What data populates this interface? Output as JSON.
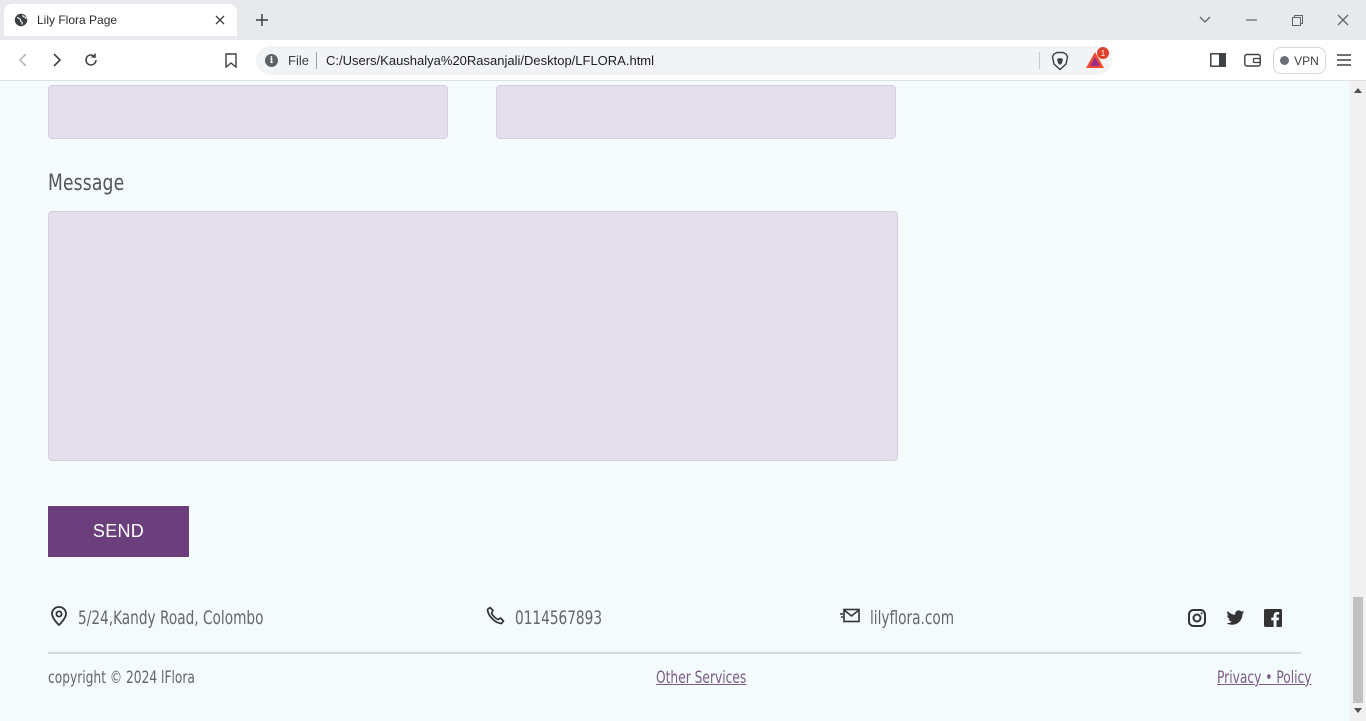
{
  "browser": {
    "tab_title": "Lily Flora Page",
    "scheme_label": "File",
    "url": "C:/Users/Kaushalya%20Rasanjali/Desktop/LFLORA.html",
    "rewards_badge": "1",
    "vpn_label": "VPN"
  },
  "form": {
    "message_label": "Message",
    "send_label": "SEND"
  },
  "footer": {
    "address": "5/24,Kandy Road, Colombo",
    "phone": "0114567893",
    "email": "lilyflora.com",
    "copyright": "copyright © 2024 lFlora",
    "other_services": "Other Services",
    "privacy": "Privacy • Policy"
  },
  "colors": {
    "page_bg": "#f3fbfd",
    "field_bg": "#e4dfea",
    "accent": "#6b3f7c"
  },
  "icons": {
    "address": "location-pin-icon",
    "phone": "phone-icon",
    "email": "mail-icon",
    "social": [
      "instagram-icon",
      "twitter-icon",
      "facebook-icon"
    ]
  }
}
